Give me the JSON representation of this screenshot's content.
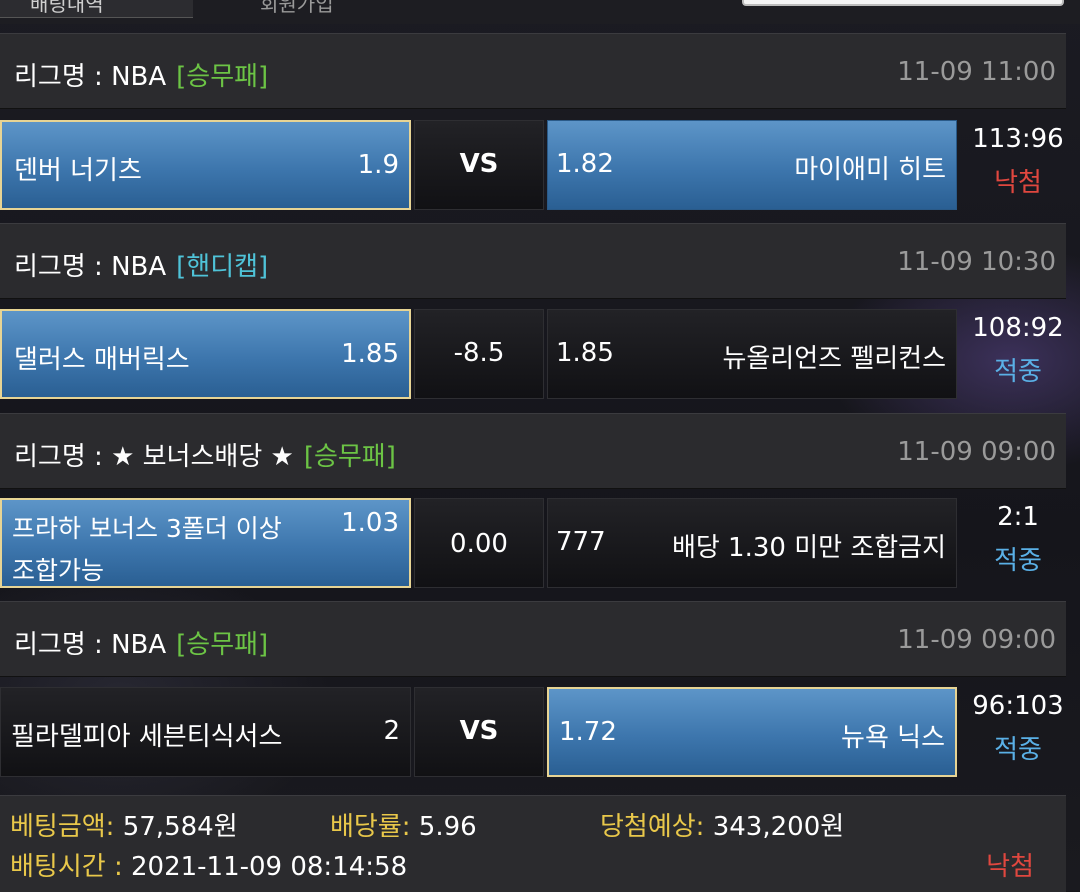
{
  "header": {
    "tab_active_label": "배팅내역",
    "tab_other_label": "회원가입"
  },
  "games": [
    {
      "league_prefix": "리그명 : ",
      "league_name": "NBA",
      "bet_type": "[승무패]",
      "datetime": "11-09 11:00",
      "home_team": "덴버 너기츠",
      "home_odds": "1.9",
      "center": "VS",
      "away_odds": "1.82",
      "away_team": "마이애미 히트",
      "score": "113:96",
      "status": "낙첨"
    },
    {
      "league_prefix": "리그명 : ",
      "league_name": "NBA",
      "bet_type": "[핸디캡]",
      "datetime": "11-09 10:30",
      "home_team": "댈러스 매버릭스",
      "home_odds": "1.85",
      "center": "-8.5",
      "away_odds": "1.85",
      "away_team": "뉴올리언즈 펠리컨스",
      "score": "108:92",
      "status": "적중"
    },
    {
      "league_prefix": "리그명 : ",
      "league_name": "★ 보너스배당 ★",
      "bet_type": "[승무패]",
      "datetime": "11-09 09:00",
      "home_team_line1": "프라하 보너스 3폴더 이상",
      "home_team_line2": "조합가능",
      "home_odds": "1.03",
      "center": "0.00",
      "away_odds": "777",
      "away_team": "배당 1.30 미만 조합금지",
      "score": "2:1",
      "status": "적중"
    },
    {
      "league_prefix": "리그명 : ",
      "league_name": "NBA",
      "bet_type": "[승무패]",
      "datetime": "11-09 09:00",
      "home_team": "필라델피아 세븐티식서스",
      "home_odds": "2",
      "center": "VS",
      "away_odds": "1.72",
      "away_team": "뉴욕 닉스",
      "score": "96:103",
      "status": "적중"
    }
  ],
  "summary": {
    "bet_amount_label": "베팅금액:",
    "bet_amount_value": "57,584원",
    "odds_label": "배당률:",
    "odds_value": "5.96",
    "expected_label": "당첨예상:",
    "expected_value": "343,200원",
    "bet_time_label": "배팅시간 :",
    "bet_time_value": "2021-11-09 08:14:58",
    "result": "낙첨"
  },
  "colors": {
    "tag_green": "#6cc445",
    "tag_cyan": "#4fc3d8",
    "status_win": "#5ab0e6",
    "status_lose": "#e0473f",
    "summary_label": "#e9c84a",
    "selected_border": "#e7d494",
    "selected_fill": "#3d76ad"
  }
}
